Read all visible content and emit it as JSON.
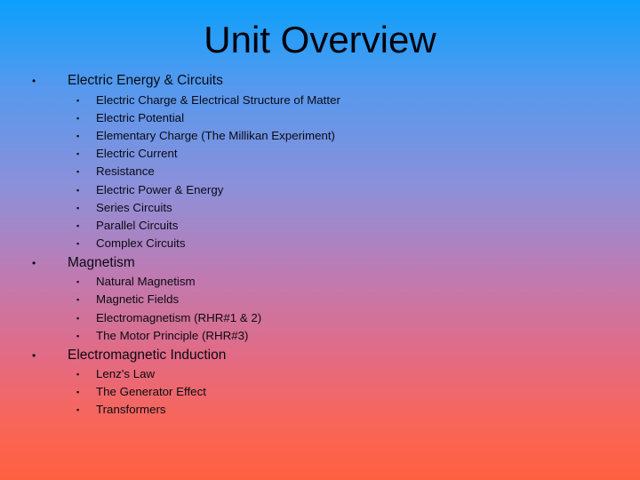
{
  "slide": {
    "title": "Unit Overview",
    "sections": [
      {
        "label": "Electric Energy & Circuits",
        "items": [
          "Electric Charge & Electrical Structure of Matter",
          "Electric Potential",
          "Elementary Charge (The Millikan Experiment)",
          "Electric Current",
          "Resistance",
          "Electric Power & Energy",
          "Series Circuits",
          "Parallel Circuits",
          "Complex Circuits"
        ]
      },
      {
        "label": "Magnetism",
        "items": [
          "Natural Magnetism",
          "Magnetic Fields",
          "Electromagnetism (RHR#1 & 2)",
          "The Motor Principle (RHR#3)"
        ]
      },
      {
        "label": "Electromagnetic Induction",
        "items": [
          "Lenz's Law",
          "The Generator Effect",
          "Transformers"
        ]
      }
    ],
    "bullet_primary": "•",
    "bullet_secondary": "▪",
    "colors": {
      "gradient_top": "#0aa0fc",
      "gradient_middle": "#c07ab0",
      "gradient_bottom": "#ff5f40",
      "text": "#0a0a14"
    }
  }
}
